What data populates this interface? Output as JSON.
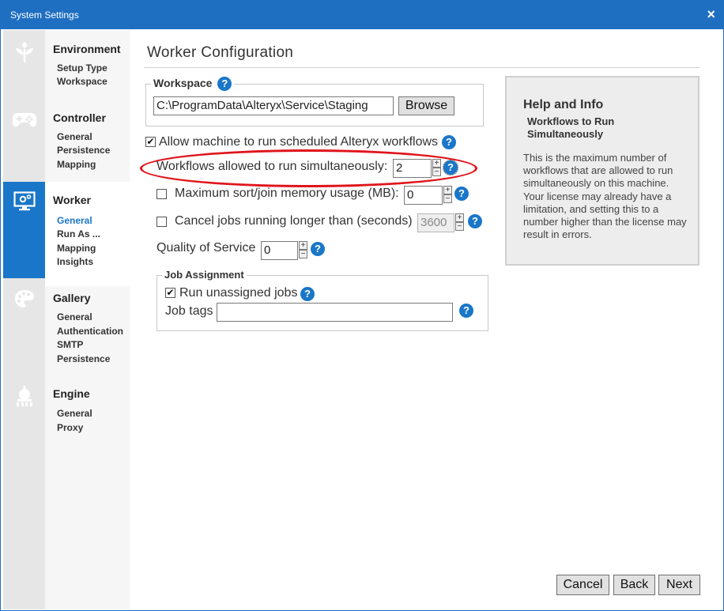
{
  "window": {
    "title": "System Settings",
    "close_glyph": "×"
  },
  "rail": [
    {
      "icon": "leaf-icon"
    },
    {
      "icon": "gamepad-icon"
    },
    {
      "icon": "monitor-gear-icon",
      "active": true
    },
    {
      "icon": "palette-icon"
    },
    {
      "icon": "engine-icon"
    }
  ],
  "nav": {
    "environment": {
      "title": "Environment",
      "items": [
        "Setup Type",
        "Workspace"
      ]
    },
    "controller": {
      "title": "Controller",
      "items": [
        "General",
        "Persistence",
        "Mapping"
      ]
    },
    "worker": {
      "title": "Worker",
      "items": [
        "General",
        "Run As ...",
        "Mapping",
        "Insights"
      ],
      "current": "General"
    },
    "gallery": {
      "title": "Gallery",
      "items": [
        "General",
        "Authentication",
        "SMTP",
        "Persistence"
      ]
    },
    "engine": {
      "title": "Engine",
      "items": [
        "General",
        "Proxy"
      ]
    }
  },
  "main": {
    "page_title": "Worker Configuration",
    "workspace": {
      "legend": "Workspace",
      "path": "C:\\ProgramData\\Alteryx\\Service\\Staging",
      "browse_label": "Browse"
    },
    "allow_machine": {
      "label": "Allow machine to run scheduled Alteryx workflows",
      "checked": "✔"
    },
    "workflows_simultaneous": {
      "label": "Workflows allowed to run simultaneously:",
      "value": "2"
    },
    "max_sort_join": {
      "label": "Maximum sort/join memory usage (MB):",
      "value": "0"
    },
    "cancel_jobs": {
      "label": "Cancel jobs running longer than (seconds)",
      "value": "3600"
    },
    "quality_of_service": {
      "label": "Quality of Service",
      "value": "0"
    },
    "job_assignment": {
      "legend": "Job Assignment",
      "run_unassigned": {
        "label": "Run unassigned jobs",
        "checked": "✔"
      },
      "job_tags": {
        "label": "Job tags",
        "value": ""
      }
    },
    "help_glyph": "?",
    "spin_plus": "+",
    "spin_minus": "−"
  },
  "help": {
    "heading": "Help and Info",
    "subheading": "Workflows to Run Simultaneously",
    "body": "This is the maximum number of workflows that are allowed to run simultaneously on this machine. Your license may already have a limitation, and setting this to a number higher than the license may result in errors."
  },
  "footer": {
    "cancel": "Cancel",
    "back": "Back",
    "next": "Next"
  },
  "colors": {
    "accent": "#1e6fc1",
    "highlight_oval": "#e0141b",
    "help_icon": "#1a76c8"
  }
}
